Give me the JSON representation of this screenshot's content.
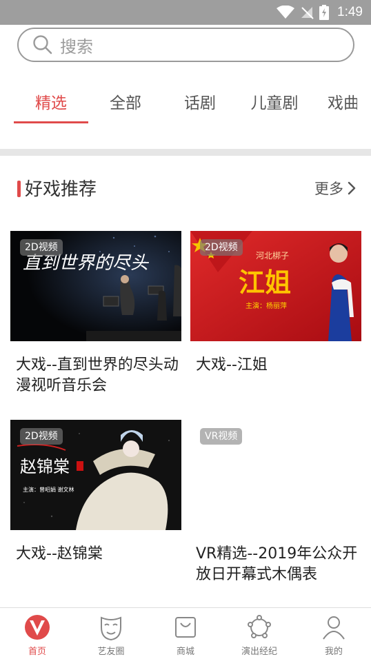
{
  "status_bar": {
    "time": "1:49"
  },
  "search": {
    "placeholder": "搜索"
  },
  "tabs": [
    {
      "label": "精选",
      "active": true
    },
    {
      "label": "全部"
    },
    {
      "label": "话剧"
    },
    {
      "label": "儿童剧"
    },
    {
      "label": "戏曲"
    }
  ],
  "section": {
    "title": "好戏推荐",
    "more_label": "更多"
  },
  "cards": [
    {
      "badge": "2D视频",
      "title": "大戏--直到世界的尽头动漫视听音乐会",
      "poster_text": "直到世界的尽头"
    },
    {
      "badge": "2D视频",
      "title": "大戏--江姐",
      "poster_text": "江姐",
      "poster_subtitle": "河北梆子",
      "poster_cast": "主演：杨丽萍"
    },
    {
      "badge": "2D视频",
      "title": "大戏--赵锦棠",
      "poster_text": "赵锦棠",
      "poster_cast": "主演：曾昭娟  谢文林"
    },
    {
      "badge": "VR视频",
      "title": "VR精选--2019年公众开放日开幕式木偶表"
    }
  ],
  "bottom_nav": [
    {
      "label": "首页",
      "icon": "home-v-logo-icon",
      "active": true
    },
    {
      "label": "艺友圈",
      "icon": "mask-icon"
    },
    {
      "label": "商城",
      "icon": "shopping-bag-icon"
    },
    {
      "label": "演出经纪",
      "icon": "broker-circle-icon"
    },
    {
      "label": "我的",
      "icon": "person-icon"
    }
  ],
  "colors": {
    "accent": "#e04a4a",
    "status_bar": "#9e9e9e",
    "divider": "#e6e6e6"
  }
}
